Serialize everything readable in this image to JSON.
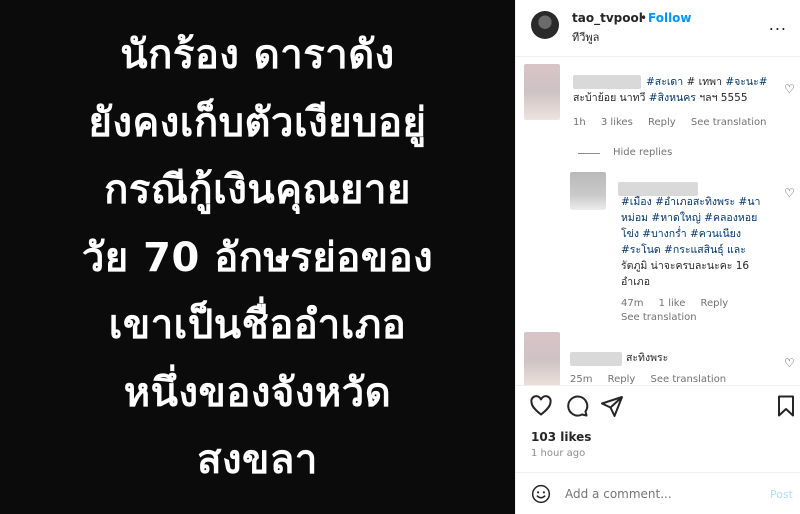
{
  "post_image": {
    "lines": [
      "นักร้อง ดาราดัง",
      "ยังคงเก็บตัวเงียบอยู่",
      "กรณีกู้เงินคุณยาย",
      "วัย 70 อักษรย่อของ",
      "เขาเป็นชื่ออำเภอ",
      "หนึ่งของจังหวัด",
      "สงขลา"
    ]
  },
  "header": {
    "username": "tao_tvpool",
    "dot": "•",
    "follow": "Follow",
    "location": "ทีวีพูล",
    "more": "..."
  },
  "comments": [
    {
      "text_line1_a": "#สะเดา",
      "text_line1_b": "# เทพา",
      "text_line1_c": "#จะนะ#",
      "text_line2_a": "สะบ้าย้อย นาทวี ",
      "text_line2_b": "#สิงหนคร",
      "text_line2_c": " ฯลฯ 5555",
      "time": "1h",
      "likes": "3 likes",
      "reply": "Reply",
      "see_translation": "See translation"
    },
    {
      "hide_replies": "Hide replies"
    },
    {
      "line1": "#เมือง #อำเภอสะทิงพระ #นา",
      "line2": "หม่อม #หาดใหญ่ #คลองหอย",
      "line3": "โข่ง #บางกร่ำ #ควนเนียง",
      "line4": "#ระโนด #กระแสสินธุ์ และ",
      "line5": "รัตภูมิ น่าจะครบละนะคะ 16",
      "line6": "อำเภอ",
      "time": "47m",
      "likes": "1 like",
      "reply": "Reply",
      "see_translation": "See translation"
    },
    {
      "text": "สะทิงพระ",
      "time": "25m",
      "reply": "Reply",
      "see_translation": "See translation"
    }
  ],
  "footer": {
    "likes": "103 likes",
    "time": "1 hour ago",
    "add_comment_placeholder": "Add a comment...",
    "post": "Post"
  },
  "colors": {
    "accent": "#0095f6",
    "hashtag": "#00376b",
    "muted": "#737373",
    "image_bg": "#0b0b0b"
  }
}
